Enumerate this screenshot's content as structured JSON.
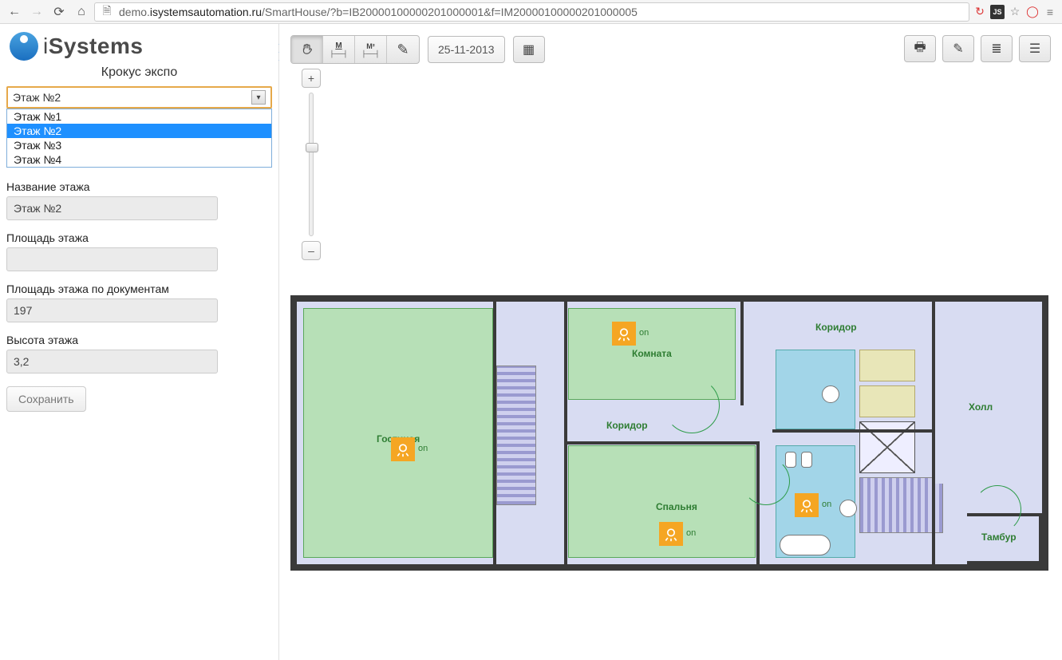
{
  "browser": {
    "url_prefix": "demo.",
    "url_domain": "isystemsautomation.ru",
    "url_path": "/SmartHouse/?b=IB20000100000201000001&f=IM20000100000201000005"
  },
  "logo": "iSystems",
  "building": "Крокус экспо",
  "floor_select": {
    "value": "Этаж №2",
    "options": [
      "Этаж №1",
      "Этаж №2",
      "Этаж №3",
      "Этаж №4"
    ],
    "selected_index": 1
  },
  "fields": {
    "name_label": "Название этажа",
    "name_value": "Этаж №2",
    "area_label": "Площадь этажа",
    "area_value": "",
    "doc_area_label": "Площадь этажа по документам",
    "doc_area_value": "197",
    "height_label": "Высота этажа",
    "height_value": "3,2"
  },
  "save_label": "Сохранить",
  "toolbar": {
    "date": "25-11-2013",
    "hand": "✋",
    "measure": "M",
    "area_measure": "M²",
    "pencil": "✎",
    "cal": "▦"
  },
  "right_toolbar": {
    "print": "🖨",
    "edit": "✎",
    "list": "≣",
    "layers": "🗂"
  },
  "zoom": {
    "plus": "+",
    "minus": "–"
  },
  "plan": {
    "rooms": {
      "living": "Гостиная",
      "room": "Комната",
      "corridor": "Коридор",
      "corridor_top": "Коридор",
      "bedroom": "Спальня",
      "hall": "Холл",
      "tambur": "Тамбур"
    },
    "light_on": "on"
  }
}
